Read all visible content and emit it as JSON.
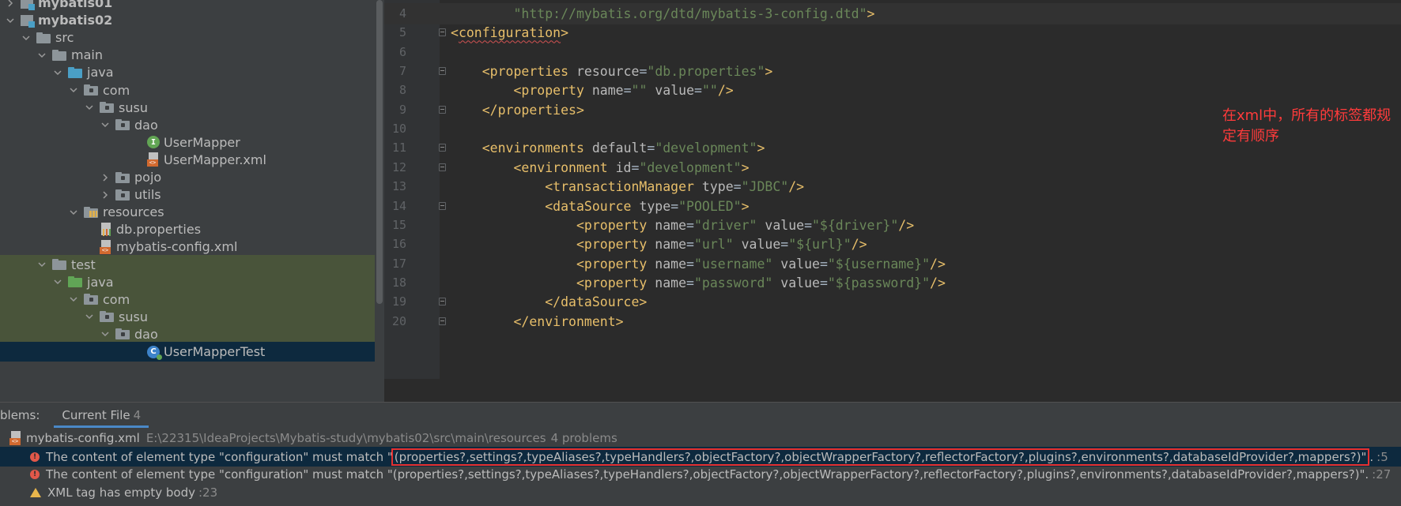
{
  "tree": {
    "items": [
      {
        "label": "mybatis01",
        "kind": "module",
        "arrow": "right",
        "bold": true
      },
      {
        "label": "mybatis02",
        "kind": "module",
        "arrow": "down",
        "bold": true
      },
      {
        "label": "src",
        "kind": "folder-plain",
        "arrow": "down"
      },
      {
        "label": "main",
        "kind": "folder-plain",
        "arrow": "down"
      },
      {
        "label": "java",
        "kind": "folder-src",
        "arrow": "down"
      },
      {
        "label": "com",
        "kind": "package",
        "arrow": "down"
      },
      {
        "label": "susu",
        "kind": "package",
        "arrow": "down"
      },
      {
        "label": "dao",
        "kind": "package",
        "arrow": "down"
      },
      {
        "label": "UserMapper",
        "kind": "interface",
        "arrow": "none"
      },
      {
        "label": "UserMapper.xml",
        "kind": "xml",
        "arrow": "none"
      },
      {
        "label": "pojo",
        "kind": "package",
        "arrow": "right"
      },
      {
        "label": "utils",
        "kind": "package",
        "arrow": "right"
      },
      {
        "label": "resources",
        "kind": "resources",
        "arrow": "down"
      },
      {
        "label": "db.properties",
        "kind": "properties",
        "arrow": "none"
      },
      {
        "label": "mybatis-config.xml",
        "kind": "xml",
        "arrow": "none"
      },
      {
        "label": "test",
        "kind": "folder-plain",
        "arrow": "down"
      },
      {
        "label": "java",
        "kind": "folder-test",
        "arrow": "down"
      },
      {
        "label": "com",
        "kind": "package",
        "arrow": "down"
      },
      {
        "label": "susu",
        "kind": "package",
        "arrow": "down"
      },
      {
        "label": "dao",
        "kind": "package",
        "arrow": "down"
      },
      {
        "label": "UserMapperTest",
        "kind": "testclass",
        "arrow": "none"
      }
    ]
  },
  "editor": {
    "lines": [
      {
        "n": "4",
        "parts": [
          [
            "plain",
            "        "
          ],
          [
            "val",
            "\"http://mybatis.org/dtd/mybatis-3-config.dtd\""
          ],
          [
            "tag",
            ">"
          ]
        ]
      },
      {
        "n": "5",
        "parts": [
          [
            "tag",
            "<"
          ],
          [
            "tagerr",
            "configuration"
          ],
          [
            "tag",
            ">"
          ]
        ]
      },
      {
        "n": "6",
        "parts": []
      },
      {
        "n": "7",
        "parts": [
          [
            "plain",
            "    "
          ],
          [
            "tag",
            "<properties "
          ],
          [
            "attr",
            "resource"
          ],
          [
            "plain",
            "="
          ],
          [
            "val",
            "\"db.properties\""
          ],
          [
            "tag",
            ">"
          ]
        ]
      },
      {
        "n": "8",
        "parts": [
          [
            "plain",
            "        "
          ],
          [
            "tag",
            "<property "
          ],
          [
            "attr",
            "name"
          ],
          [
            "plain",
            "="
          ],
          [
            "val",
            "\"\" "
          ],
          [
            "attr",
            "value"
          ],
          [
            "plain",
            "="
          ],
          [
            "val",
            "\"\""
          ],
          [
            "tag",
            "/>"
          ]
        ]
      },
      {
        "n": "9",
        "parts": [
          [
            "plain",
            "    "
          ],
          [
            "tag",
            "</properties>"
          ]
        ]
      },
      {
        "n": "10",
        "parts": []
      },
      {
        "n": "11",
        "parts": [
          [
            "plain",
            "    "
          ],
          [
            "tag",
            "<environments "
          ],
          [
            "attr",
            "default"
          ],
          [
            "plain",
            "="
          ],
          [
            "val",
            "\"development\""
          ],
          [
            "tag",
            ">"
          ]
        ]
      },
      {
        "n": "12",
        "parts": [
          [
            "plain",
            "        "
          ],
          [
            "tag",
            "<environment "
          ],
          [
            "attr",
            "id"
          ],
          [
            "plain",
            "="
          ],
          [
            "val",
            "\"development\""
          ],
          [
            "tag",
            ">"
          ]
        ]
      },
      {
        "n": "13",
        "parts": [
          [
            "plain",
            "            "
          ],
          [
            "tag",
            "<transactionManager "
          ],
          [
            "attr",
            "type"
          ],
          [
            "plain",
            "="
          ],
          [
            "val",
            "\"JDBC\""
          ],
          [
            "tag",
            "/>"
          ]
        ]
      },
      {
        "n": "14",
        "parts": [
          [
            "plain",
            "            "
          ],
          [
            "tag",
            "<dataSource "
          ],
          [
            "attr",
            "type"
          ],
          [
            "plain",
            "="
          ],
          [
            "val",
            "\"POOLED\""
          ],
          [
            "tag",
            ">"
          ]
        ]
      },
      {
        "n": "15",
        "parts": [
          [
            "plain",
            "                "
          ],
          [
            "tag",
            "<property "
          ],
          [
            "attr",
            "name"
          ],
          [
            "plain",
            "="
          ],
          [
            "val",
            "\"driver\" "
          ],
          [
            "attr",
            "value"
          ],
          [
            "plain",
            "="
          ],
          [
            "val",
            "\"${driver}\""
          ],
          [
            "tag",
            "/>"
          ]
        ]
      },
      {
        "n": "16",
        "parts": [
          [
            "plain",
            "                "
          ],
          [
            "tag",
            "<property "
          ],
          [
            "attr",
            "name"
          ],
          [
            "plain",
            "="
          ],
          [
            "val",
            "\"url\" "
          ],
          [
            "attr",
            "value"
          ],
          [
            "plain",
            "="
          ],
          [
            "val",
            "\"${url}\""
          ],
          [
            "tag",
            "/>"
          ]
        ]
      },
      {
        "n": "17",
        "parts": [
          [
            "plain",
            "                "
          ],
          [
            "tag",
            "<property "
          ],
          [
            "attr",
            "name"
          ],
          [
            "plain",
            "="
          ],
          [
            "val",
            "\"username\" "
          ],
          [
            "attr",
            "value"
          ],
          [
            "plain",
            "="
          ],
          [
            "val",
            "\"${username}\""
          ],
          [
            "tag",
            "/>"
          ]
        ]
      },
      {
        "n": "18",
        "parts": [
          [
            "plain",
            "                "
          ],
          [
            "tag",
            "<property "
          ],
          [
            "attr",
            "name"
          ],
          [
            "plain",
            "="
          ],
          [
            "val",
            "\"password\" "
          ],
          [
            "attr",
            "value"
          ],
          [
            "plain",
            "="
          ],
          [
            "val",
            "\"${password}\""
          ],
          [
            "tag",
            "/>"
          ]
        ]
      },
      {
        "n": "19",
        "parts": [
          [
            "plain",
            "            "
          ],
          [
            "tag",
            "</dataSource>"
          ]
        ]
      },
      {
        "n": "20",
        "parts": [
          [
            "plain",
            "        "
          ],
          [
            "tag",
            "</environment>"
          ]
        ]
      }
    ],
    "annotation": "在xml中，所有的标签都规定有顺序"
  },
  "problems": {
    "title": "blems:",
    "tab_label": "Current File",
    "tab_count": "4",
    "file_name": "mybatis-config.xml",
    "file_path": "E:\\22315\\IdeaProjects\\Mybatis-study\\mybatis02\\src\\main\\resources",
    "file_count": "4 problems",
    "rows": [
      {
        "severity": "error",
        "prefix": "The content of element type \"configuration\" must match \"",
        "highlight": "(properties?,settings?,typeAliases?,typeHandlers?,objectFactory?,objectWrapperFactory?,reflectorFactory?,plugins?,environments?,databaseIdProvider?,mappers?)\"",
        "suffix": ".",
        "loc": ":5"
      },
      {
        "severity": "error",
        "prefix": "The content of element type \"configuration\" must match \"(properties?,settings?,typeAliases?,typeHandlers?,objectFactory?,objectWrapperFactory?,reflectorFactory?,plugins?,environments?,databaseIdProvider?,mappers?)\"",
        "highlight": "",
        "suffix": ".",
        "loc": ":27"
      },
      {
        "severity": "warning",
        "prefix": "XML tag has empty body",
        "highlight": "",
        "suffix": "",
        "loc": ":23"
      }
    ]
  },
  "colors": {
    "tag": "#e8bf6a",
    "value": "#6a8759",
    "attr": "#bababa",
    "annotation": "#ff3b3b",
    "error": "#e2584a",
    "warning": "#e8b64c",
    "highlight_box": "#e53030"
  }
}
